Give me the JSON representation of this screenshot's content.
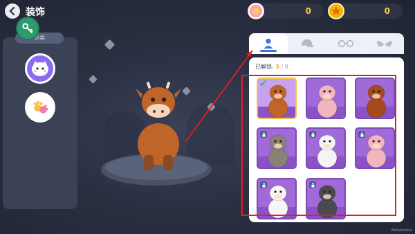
{
  "header": {
    "title": "装饰",
    "back_icon": "chevron-left-icon",
    "key_icon": "key-icon"
  },
  "category_panel": {
    "tab_label": "分类",
    "items": [
      {
        "name": "animal-category",
        "icon": "white-face-icon",
        "selected": true
      },
      {
        "name": "accessory-category",
        "icon": "paw-icon",
        "selected": false
      }
    ]
  },
  "resources": {
    "flower": {
      "icon": "flower-badge-icon",
      "value": "0"
    },
    "star": {
      "icon": "star-coin-icon",
      "value": "0"
    }
  },
  "tabs": [
    {
      "name": "character",
      "icon": "person-icon",
      "active": true
    },
    {
      "name": "hat",
      "icon": "cap-icon",
      "active": false
    },
    {
      "name": "glasses",
      "icon": "glasses-icon",
      "active": false
    },
    {
      "name": "wings",
      "icon": "wings-icon",
      "active": false
    }
  ],
  "unlock": {
    "label": "已解锁:",
    "current": "3",
    "total": "/ 8"
  },
  "characters": [
    {
      "name": "brown-cow",
      "locked": false,
      "selected": true,
      "color": "#c0652a"
    },
    {
      "name": "pink-pig",
      "locked": false,
      "selected": false,
      "color": "#f2b5bf"
    },
    {
      "name": "brown-rooster",
      "locked": false,
      "selected": false,
      "color": "#a54a1c"
    },
    {
      "name": "gray-goat",
      "locked": true,
      "selected": false,
      "color": "#8a8278"
    },
    {
      "name": "spotted-cow",
      "locked": true,
      "selected": false,
      "color": "#f4f4f6"
    },
    {
      "name": "pink-pig-2",
      "locked": true,
      "selected": false,
      "color": "#f2b5bf"
    },
    {
      "name": "white-chicken",
      "locked": true,
      "selected": false,
      "color": "#f6f6f6"
    },
    {
      "name": "black-goat",
      "locked": true,
      "selected": false,
      "color": "#4a4a50"
    }
  ],
  "watermark": "Wallvinestar",
  "colors": {
    "accent": "#3b73e0",
    "highlight": "#e02020",
    "card": "#a06ad8",
    "gold": "#ffc93a"
  }
}
